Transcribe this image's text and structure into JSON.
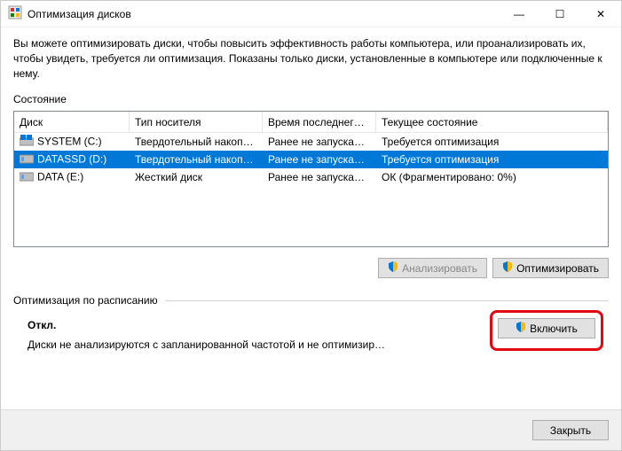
{
  "window": {
    "title": "Оптимизация дисков",
    "minimize": "—",
    "maximize": "☐",
    "close": "✕"
  },
  "description": "Вы можете оптимизировать диски, чтобы повысить эффективность работы  компьютера, или проанализировать их, чтобы увидеть, требуется ли оптимизация. Показаны только диски, установленные в компьютере или подключенные к нему.",
  "status_label": "Состояние",
  "columns": {
    "drive": "Диск",
    "media": "Тип носителя",
    "last": "Время последнег…",
    "state": "Текущее состояние"
  },
  "rows": [
    {
      "drive": "SYSTEM (C:)",
      "media": "Твердотельный накоп…",
      "last": "Ранее не запуска…",
      "state": "Требуется оптимизация",
      "selected": false,
      "icon": "win"
    },
    {
      "drive": "DATASSD (D:)",
      "media": "Твердотельный накоп…",
      "last": "Ранее не запуска…",
      "state": "Требуется оптимизация",
      "selected": true,
      "icon": "ssd"
    },
    {
      "drive": "DATA (E:)",
      "media": "Жесткий диск",
      "last": "Ранее не запуска…",
      "state": "ОК (Фрагментировано: 0%)",
      "selected": false,
      "icon": "hdd"
    }
  ],
  "buttons": {
    "analyze": "Анализировать",
    "optimize": "Оптимизировать",
    "enable": "Включить",
    "close": "Закрыть"
  },
  "schedule": {
    "label": "Оптимизация по расписанию",
    "status": "Откл.",
    "detail": "Диски не анализируются с запланированной частотой и не оптимизир…"
  }
}
